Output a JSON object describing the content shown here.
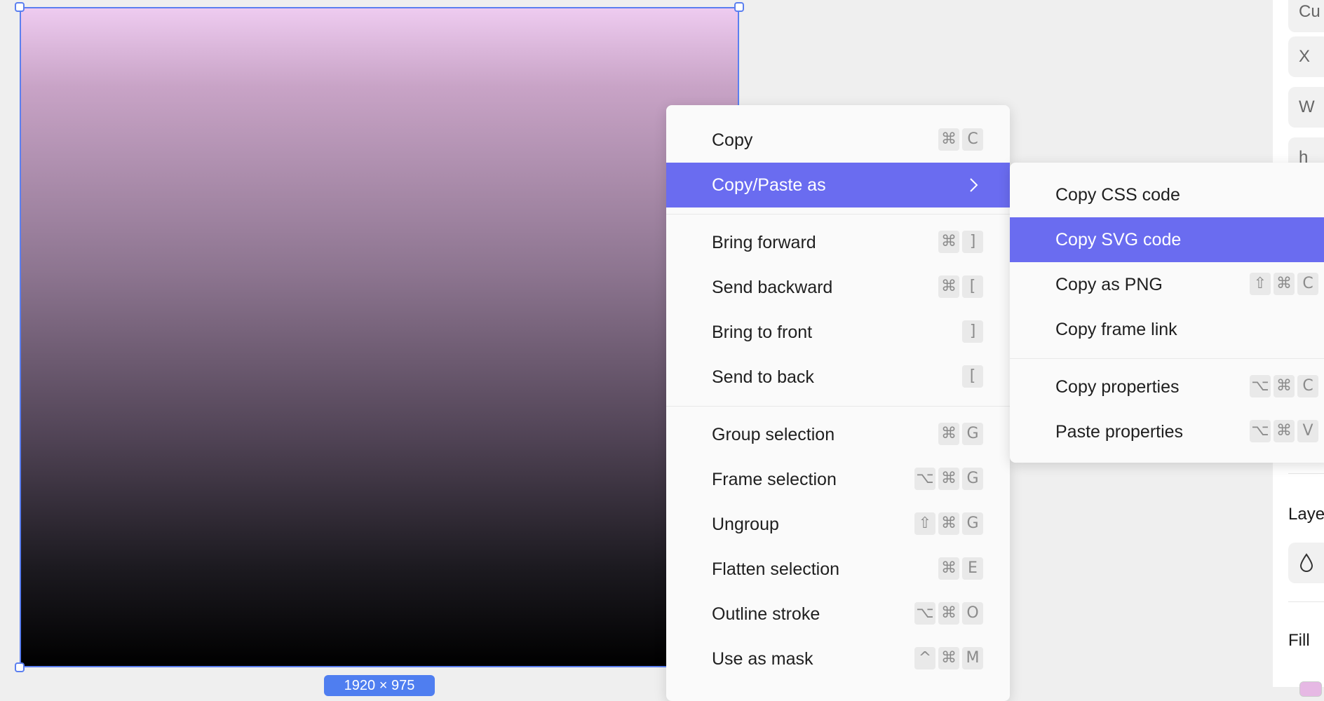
{
  "canvas": {
    "frame_size_label": "1920 × 975"
  },
  "context_menu": {
    "groups": [
      [
        {
          "name": "copy",
          "label": "Copy",
          "keys": [
            "⌘",
            "C"
          ]
        },
        {
          "name": "copy-paste-as",
          "label": "Copy/Paste as",
          "keys": [],
          "submenu": true,
          "active": true
        }
      ],
      [
        {
          "name": "bring-forward",
          "label": "Bring forward",
          "keys": [
            "⌘",
            "]"
          ]
        },
        {
          "name": "send-backward",
          "label": "Send backward",
          "keys": [
            "⌘",
            "["
          ]
        },
        {
          "name": "bring-to-front",
          "label": "Bring to front",
          "keys": [
            "]"
          ]
        },
        {
          "name": "send-to-back",
          "label": "Send to back",
          "keys": [
            "["
          ]
        }
      ],
      [
        {
          "name": "group-selection",
          "label": "Group selection",
          "keys": [
            "⌘",
            "G"
          ]
        },
        {
          "name": "frame-selection",
          "label": "Frame selection",
          "keys": [
            "⌥",
            "⌘",
            "G"
          ]
        },
        {
          "name": "ungroup",
          "label": "Ungroup",
          "keys": [
            "⇧",
            "⌘",
            "G"
          ]
        },
        {
          "name": "flatten-selection",
          "label": "Flatten selection",
          "keys": [
            "⌘",
            "E"
          ]
        },
        {
          "name": "outline-stroke",
          "label": "Outline stroke",
          "keys": [
            "⌥",
            "⌘",
            "O"
          ]
        },
        {
          "name": "use-as-mask",
          "label": "Use as mask",
          "keys": [
            "^",
            "⌘",
            "M"
          ]
        }
      ]
    ]
  },
  "submenu": {
    "groups": [
      [
        {
          "name": "copy-css-code",
          "label": "Copy CSS code",
          "keys": []
        },
        {
          "name": "copy-svg-code",
          "label": "Copy SVG code",
          "keys": [],
          "active": true
        },
        {
          "name": "copy-as-png",
          "label": "Copy as PNG",
          "keys": [
            "⇧",
            "⌘",
            "C"
          ]
        },
        {
          "name": "copy-frame-link",
          "label": "Copy frame link",
          "keys": []
        }
      ],
      [
        {
          "name": "copy-properties",
          "label": "Copy properties",
          "keys": [
            "⌥",
            "⌘",
            "C"
          ]
        },
        {
          "name": "paste-properties",
          "label": "Paste properties",
          "keys": [
            "⌥",
            "⌘",
            "V"
          ]
        }
      ]
    ]
  },
  "right_panel": {
    "top_field": "Cu",
    "x_field": "X",
    "w_field": "W",
    "h_field": "h",
    "layer_label": "Laye",
    "fill_label": "Fill",
    "fill_color": "#e6b8e4"
  }
}
